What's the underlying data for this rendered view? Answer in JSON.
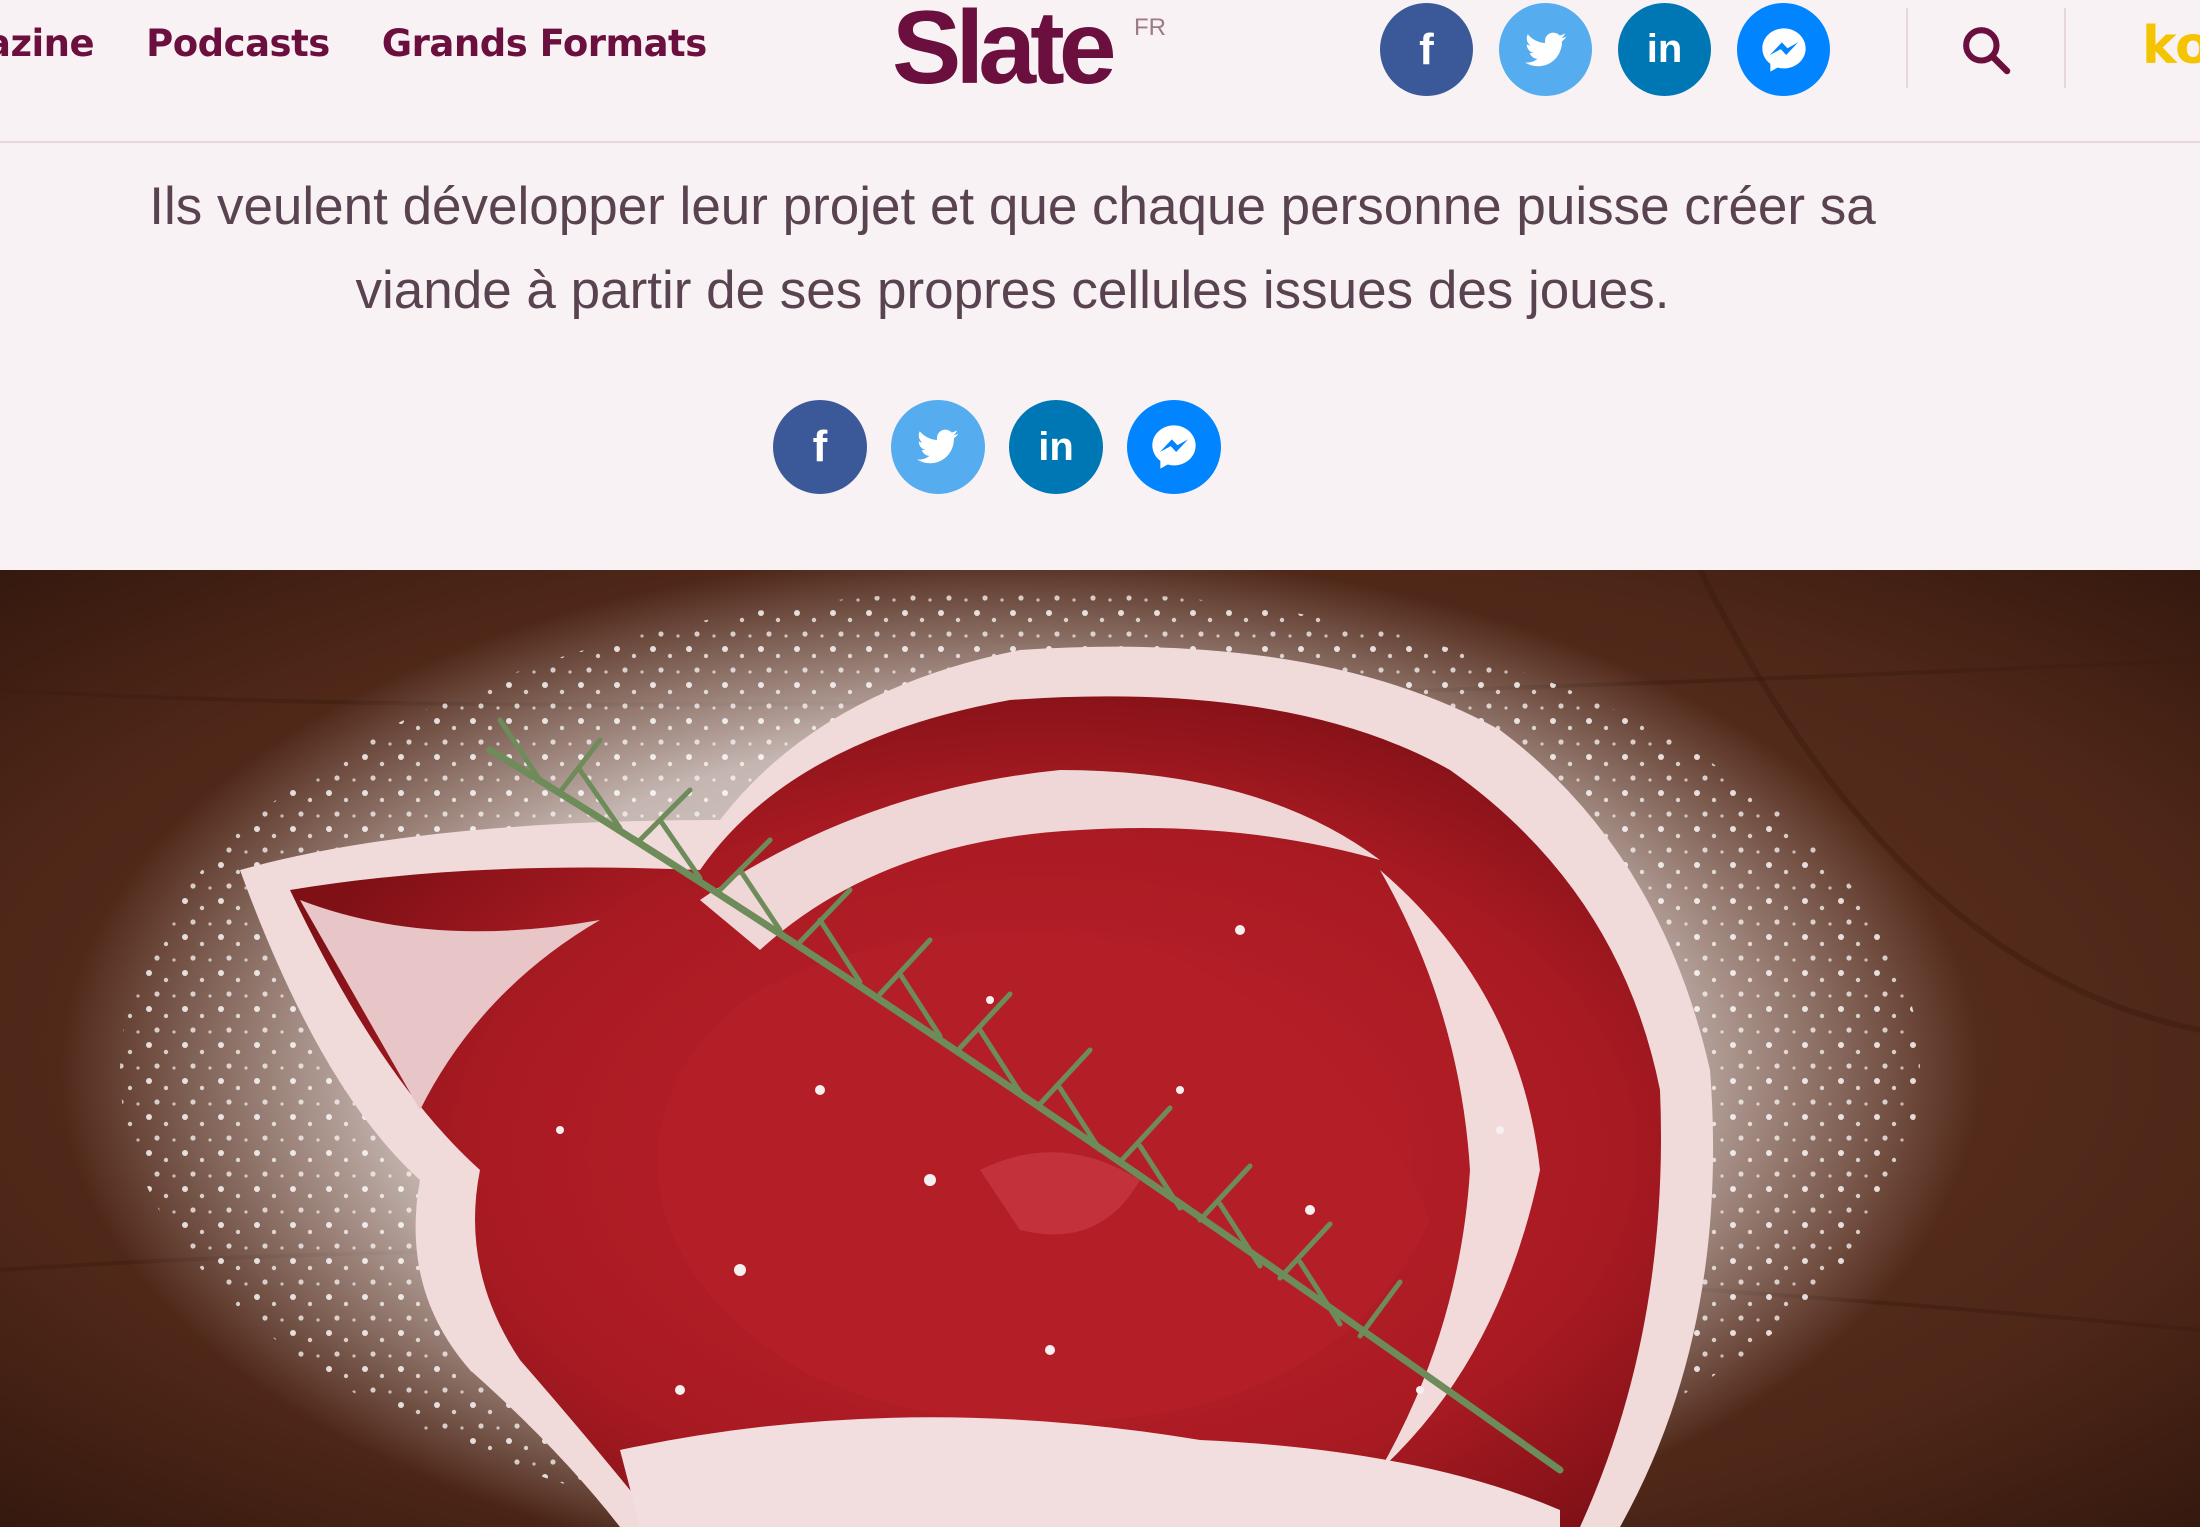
{
  "nav": {
    "items": [
      "azine",
      "Podcasts",
      "Grands Formats"
    ]
  },
  "logo": {
    "text": "Slate",
    "sup": "FR"
  },
  "share": {
    "facebook": "f",
    "linkedin": "in"
  },
  "header": {
    "kiosk_partial": "ko"
  },
  "article": {
    "chapo_line1": "Ils veulent développer leur projet et que chaque personne puisse créer sa",
    "chapo_line2": "viande à partir de ses propres cellules issues des joues."
  },
  "icons": {
    "facebook": "facebook-icon",
    "twitter": "twitter-bird-icon",
    "linkedin": "linkedin-icon",
    "messenger": "messenger-icon",
    "search": "magnifier-icon"
  },
  "colors": {
    "brand": "#6b0f3e",
    "background": "#f9f2f4",
    "facebook": "#3b5998",
    "twitter": "#55acee",
    "linkedin": "#0077b5",
    "messenger": "#0084ff",
    "kiosk": "#f5c400"
  }
}
